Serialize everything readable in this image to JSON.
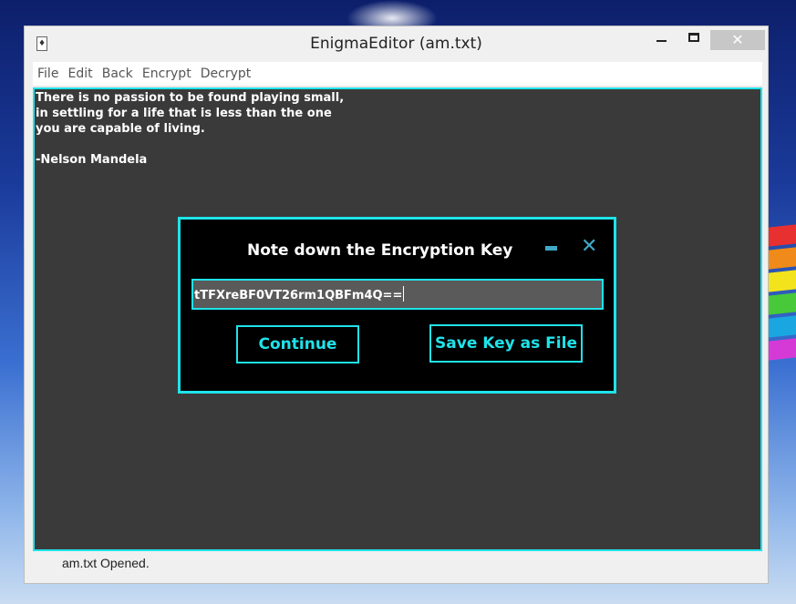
{
  "window": {
    "title": "EnigmaEditor (am.txt)",
    "close_glyph": "✕"
  },
  "menu": [
    "File",
    "Edit",
    "Back",
    "Encrypt",
    "Decrypt"
  ],
  "editor": {
    "lines": [
      "There is no passion to be found playing small,",
      "in settling for a life that is less than the one",
      "you are capable of living.",
      "",
      "-Nelson Mandela"
    ]
  },
  "dialog": {
    "title": "Note down the Encryption Key",
    "close_glyph": "✕",
    "key_value": "tTFXreBF0VT26rm1QBFm4Q==",
    "continue_label": "Continue",
    "save_label": "Save Key as File",
    "accent_color": "#1fe3ea"
  },
  "status": {
    "text": "am.txt Opened."
  },
  "icons": [
    "app-icon",
    "minimize-icon",
    "maximize-icon",
    "close-icon",
    "dialog-minimize-icon",
    "dialog-close-icon"
  ]
}
